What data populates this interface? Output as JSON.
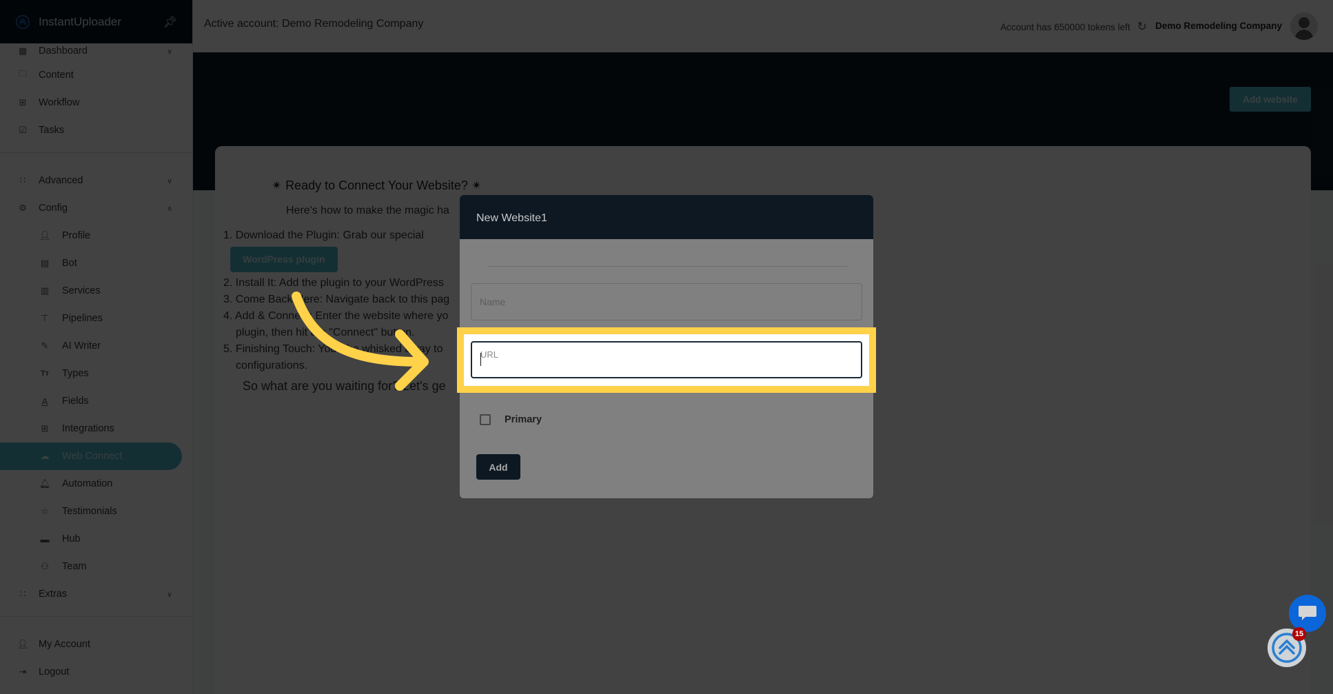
{
  "app": {
    "name": "InstantUploader"
  },
  "header": {
    "active_account": "Active account: Demo Remodeling Company",
    "tokens": "Account has 650000 tokens left",
    "account_name": "Demo Remodeling Company"
  },
  "sidebar": {
    "items": [
      {
        "label": "Dashboard",
        "icon": "dashboard-icon",
        "chevron": "down"
      },
      {
        "label": "Content",
        "icon": "folder-icon"
      },
      {
        "label": "Workflow",
        "icon": "grid-icon"
      },
      {
        "label": "Tasks",
        "icon": "checkbox-icon"
      }
    ],
    "groups": [
      {
        "label": "Advanced",
        "icon": "apps-icon",
        "chevron": "down"
      },
      {
        "label": "Config",
        "icon": "gear-icon",
        "chevron": "up"
      }
    ],
    "config_items": [
      {
        "label": "Profile",
        "icon": "user-icon"
      },
      {
        "label": "Bot",
        "icon": "message-icon"
      },
      {
        "label": "Services",
        "icon": "building-icon"
      },
      {
        "label": "Pipelines",
        "icon": "pipeline-icon"
      },
      {
        "label": "AI Writer",
        "icon": "pencil-icon"
      },
      {
        "label": "Types",
        "icon": "text-size-icon"
      },
      {
        "label": "Fields",
        "icon": "field-icon"
      },
      {
        "label": "Integrations",
        "icon": "plus-square-icon"
      },
      {
        "label": "Web Connect",
        "icon": "cloud-icon",
        "active": true
      },
      {
        "label": "Automation",
        "icon": "bell-icon"
      },
      {
        "label": "Testimonials",
        "icon": "star-icon"
      },
      {
        "label": "Hub",
        "icon": "hub-icon"
      },
      {
        "label": "Team",
        "icon": "team-icon"
      }
    ],
    "extras": {
      "label": "Extras",
      "icon": "apps-icon",
      "chevron": "down"
    },
    "bottom": [
      {
        "label": "My Account",
        "icon": "user-icon"
      },
      {
        "label": "Logout",
        "icon": "logout-icon"
      }
    ]
  },
  "toolbar": {
    "add_website_label": "Add website"
  },
  "card": {
    "title": "Ready to Connect Your Website?",
    "subtitle": "Here's how to make the magic ha",
    "steps": [
      "1. Download the Plugin: Grab our special",
      "2. Install It: Add the plugin to your WordPress",
      "3. Come Back Here: Navigate back to this pag",
      "4. Add & Connect: Enter the website where yo plugin, then hit the \"Connect\" button.",
      "5. Finishing Touch: You'll be whisked away to configurations."
    ],
    "plugin_button": "WordPress plugin",
    "closing": "So what are you waiting for? Let's ge"
  },
  "modal": {
    "title": "New Website1",
    "name_placeholder": "Name",
    "url_placeholder": "URL",
    "url_value": "",
    "primary_label": "Primary",
    "primary_checked": false,
    "add_label": "Add"
  },
  "widgets": {
    "notification_count": "15"
  },
  "colors": {
    "accent": "#4fb5c9",
    "highlight": "#ffd24a",
    "dark": "#0d1822",
    "chat": "#0b66d9",
    "badge": "#b00000"
  }
}
